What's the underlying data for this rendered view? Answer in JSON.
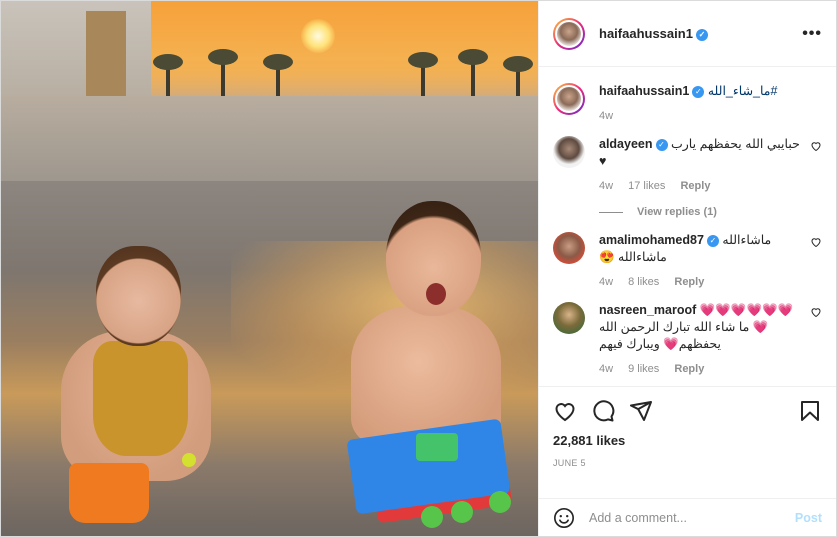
{
  "post": {
    "author": "haifaahussain1",
    "caption": "#ما_شاء_الله",
    "caption_age": "4w",
    "likes": "22,881 likes",
    "date": "JUNE 5"
  },
  "header": {
    "more_label": "•••"
  },
  "comments": [
    {
      "username": "aldayeen",
      "verified": true,
      "text": "حبايبي الله يحفظهم يارب ♥",
      "age": "4w",
      "likes": "17 likes",
      "reply": "Reply",
      "view_replies": "View replies (1)"
    },
    {
      "username": "amalimohamed87",
      "verified": true,
      "text": "ماشاءالله ماشاءالله 😍",
      "age": "4w",
      "likes": "8 likes",
      "reply": "Reply"
    },
    {
      "username": "nasreen_maroof",
      "verified": false,
      "text": "💗💗💗💗💗💗💗 ما شاء الله تبارك الرحمن الله يحفظهم💗 ويبارك فيهم",
      "age": "4w",
      "likes": "9 likes",
      "reply": "Reply"
    }
  ],
  "composer": {
    "placeholder": "Add a comment...",
    "post_label": "Post"
  },
  "icons": {
    "like": "heart-icon",
    "comment": "comment-icon",
    "share": "paper-plane-icon",
    "save": "bookmark-icon",
    "emoji": "smile-icon",
    "verified": "verified-badge-icon"
  },
  "colors": {
    "verified": "#3897f0",
    "post_disabled": "#b2dffc",
    "muted": "#8e8e8e"
  }
}
